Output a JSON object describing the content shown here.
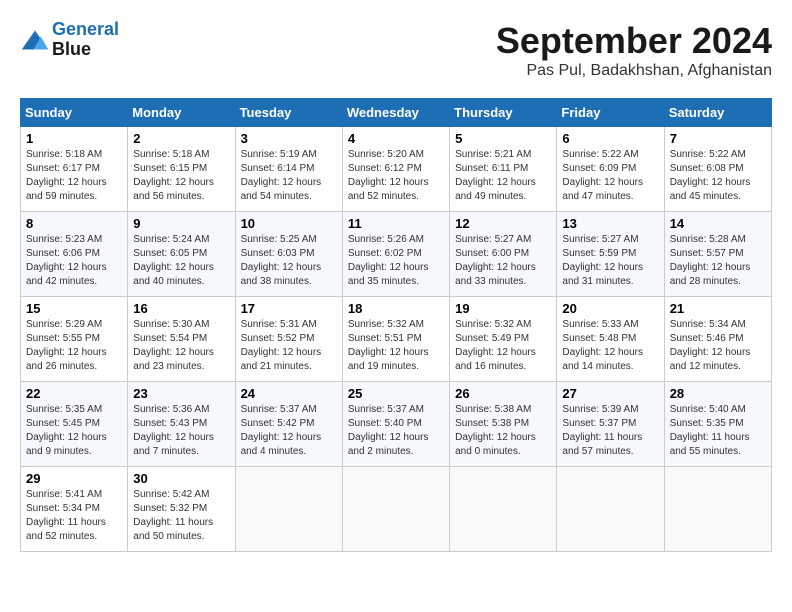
{
  "logo": {
    "line1": "General",
    "line2": "Blue"
  },
  "title": "September 2024",
  "location": "Pas Pul, Badakhshan, Afghanistan",
  "days_of_week": [
    "Sunday",
    "Monday",
    "Tuesday",
    "Wednesday",
    "Thursday",
    "Friday",
    "Saturday"
  ],
  "weeks": [
    [
      {
        "day": "1",
        "sunrise": "Sunrise: 5:18 AM",
        "sunset": "Sunset: 6:17 PM",
        "daylight": "Daylight: 12 hours and 59 minutes."
      },
      {
        "day": "2",
        "sunrise": "Sunrise: 5:18 AM",
        "sunset": "Sunset: 6:15 PM",
        "daylight": "Daylight: 12 hours and 56 minutes."
      },
      {
        "day": "3",
        "sunrise": "Sunrise: 5:19 AM",
        "sunset": "Sunset: 6:14 PM",
        "daylight": "Daylight: 12 hours and 54 minutes."
      },
      {
        "day": "4",
        "sunrise": "Sunrise: 5:20 AM",
        "sunset": "Sunset: 6:12 PM",
        "daylight": "Daylight: 12 hours and 52 minutes."
      },
      {
        "day": "5",
        "sunrise": "Sunrise: 5:21 AM",
        "sunset": "Sunset: 6:11 PM",
        "daylight": "Daylight: 12 hours and 49 minutes."
      },
      {
        "day": "6",
        "sunrise": "Sunrise: 5:22 AM",
        "sunset": "Sunset: 6:09 PM",
        "daylight": "Daylight: 12 hours and 47 minutes."
      },
      {
        "day": "7",
        "sunrise": "Sunrise: 5:22 AM",
        "sunset": "Sunset: 6:08 PM",
        "daylight": "Daylight: 12 hours and 45 minutes."
      }
    ],
    [
      {
        "day": "8",
        "sunrise": "Sunrise: 5:23 AM",
        "sunset": "Sunset: 6:06 PM",
        "daylight": "Daylight: 12 hours and 42 minutes."
      },
      {
        "day": "9",
        "sunrise": "Sunrise: 5:24 AM",
        "sunset": "Sunset: 6:05 PM",
        "daylight": "Daylight: 12 hours and 40 minutes."
      },
      {
        "day": "10",
        "sunrise": "Sunrise: 5:25 AM",
        "sunset": "Sunset: 6:03 PM",
        "daylight": "Daylight: 12 hours and 38 minutes."
      },
      {
        "day": "11",
        "sunrise": "Sunrise: 5:26 AM",
        "sunset": "Sunset: 6:02 PM",
        "daylight": "Daylight: 12 hours and 35 minutes."
      },
      {
        "day": "12",
        "sunrise": "Sunrise: 5:27 AM",
        "sunset": "Sunset: 6:00 PM",
        "daylight": "Daylight: 12 hours and 33 minutes."
      },
      {
        "day": "13",
        "sunrise": "Sunrise: 5:27 AM",
        "sunset": "Sunset: 5:59 PM",
        "daylight": "Daylight: 12 hours and 31 minutes."
      },
      {
        "day": "14",
        "sunrise": "Sunrise: 5:28 AM",
        "sunset": "Sunset: 5:57 PM",
        "daylight": "Daylight: 12 hours and 28 minutes."
      }
    ],
    [
      {
        "day": "15",
        "sunrise": "Sunrise: 5:29 AM",
        "sunset": "Sunset: 5:55 PM",
        "daylight": "Daylight: 12 hours and 26 minutes."
      },
      {
        "day": "16",
        "sunrise": "Sunrise: 5:30 AM",
        "sunset": "Sunset: 5:54 PM",
        "daylight": "Daylight: 12 hours and 23 minutes."
      },
      {
        "day": "17",
        "sunrise": "Sunrise: 5:31 AM",
        "sunset": "Sunset: 5:52 PM",
        "daylight": "Daylight: 12 hours and 21 minutes."
      },
      {
        "day": "18",
        "sunrise": "Sunrise: 5:32 AM",
        "sunset": "Sunset: 5:51 PM",
        "daylight": "Daylight: 12 hours and 19 minutes."
      },
      {
        "day": "19",
        "sunrise": "Sunrise: 5:32 AM",
        "sunset": "Sunset: 5:49 PM",
        "daylight": "Daylight: 12 hours and 16 minutes."
      },
      {
        "day": "20",
        "sunrise": "Sunrise: 5:33 AM",
        "sunset": "Sunset: 5:48 PM",
        "daylight": "Daylight: 12 hours and 14 minutes."
      },
      {
        "day": "21",
        "sunrise": "Sunrise: 5:34 AM",
        "sunset": "Sunset: 5:46 PM",
        "daylight": "Daylight: 12 hours and 12 minutes."
      }
    ],
    [
      {
        "day": "22",
        "sunrise": "Sunrise: 5:35 AM",
        "sunset": "Sunset: 5:45 PM",
        "daylight": "Daylight: 12 hours and 9 minutes."
      },
      {
        "day": "23",
        "sunrise": "Sunrise: 5:36 AM",
        "sunset": "Sunset: 5:43 PM",
        "daylight": "Daylight: 12 hours and 7 minutes."
      },
      {
        "day": "24",
        "sunrise": "Sunrise: 5:37 AM",
        "sunset": "Sunset: 5:42 PM",
        "daylight": "Daylight: 12 hours and 4 minutes."
      },
      {
        "day": "25",
        "sunrise": "Sunrise: 5:37 AM",
        "sunset": "Sunset: 5:40 PM",
        "daylight": "Daylight: 12 hours and 2 minutes."
      },
      {
        "day": "26",
        "sunrise": "Sunrise: 5:38 AM",
        "sunset": "Sunset: 5:38 PM",
        "daylight": "Daylight: 12 hours and 0 minutes."
      },
      {
        "day": "27",
        "sunrise": "Sunrise: 5:39 AM",
        "sunset": "Sunset: 5:37 PM",
        "daylight": "Daylight: 11 hours and 57 minutes."
      },
      {
        "day": "28",
        "sunrise": "Sunrise: 5:40 AM",
        "sunset": "Sunset: 5:35 PM",
        "daylight": "Daylight: 11 hours and 55 minutes."
      }
    ],
    [
      {
        "day": "29",
        "sunrise": "Sunrise: 5:41 AM",
        "sunset": "Sunset: 5:34 PM",
        "daylight": "Daylight: 11 hours and 52 minutes."
      },
      {
        "day": "30",
        "sunrise": "Sunrise: 5:42 AM",
        "sunset": "Sunset: 5:32 PM",
        "daylight": "Daylight: 11 hours and 50 minutes."
      },
      null,
      null,
      null,
      null,
      null
    ]
  ]
}
